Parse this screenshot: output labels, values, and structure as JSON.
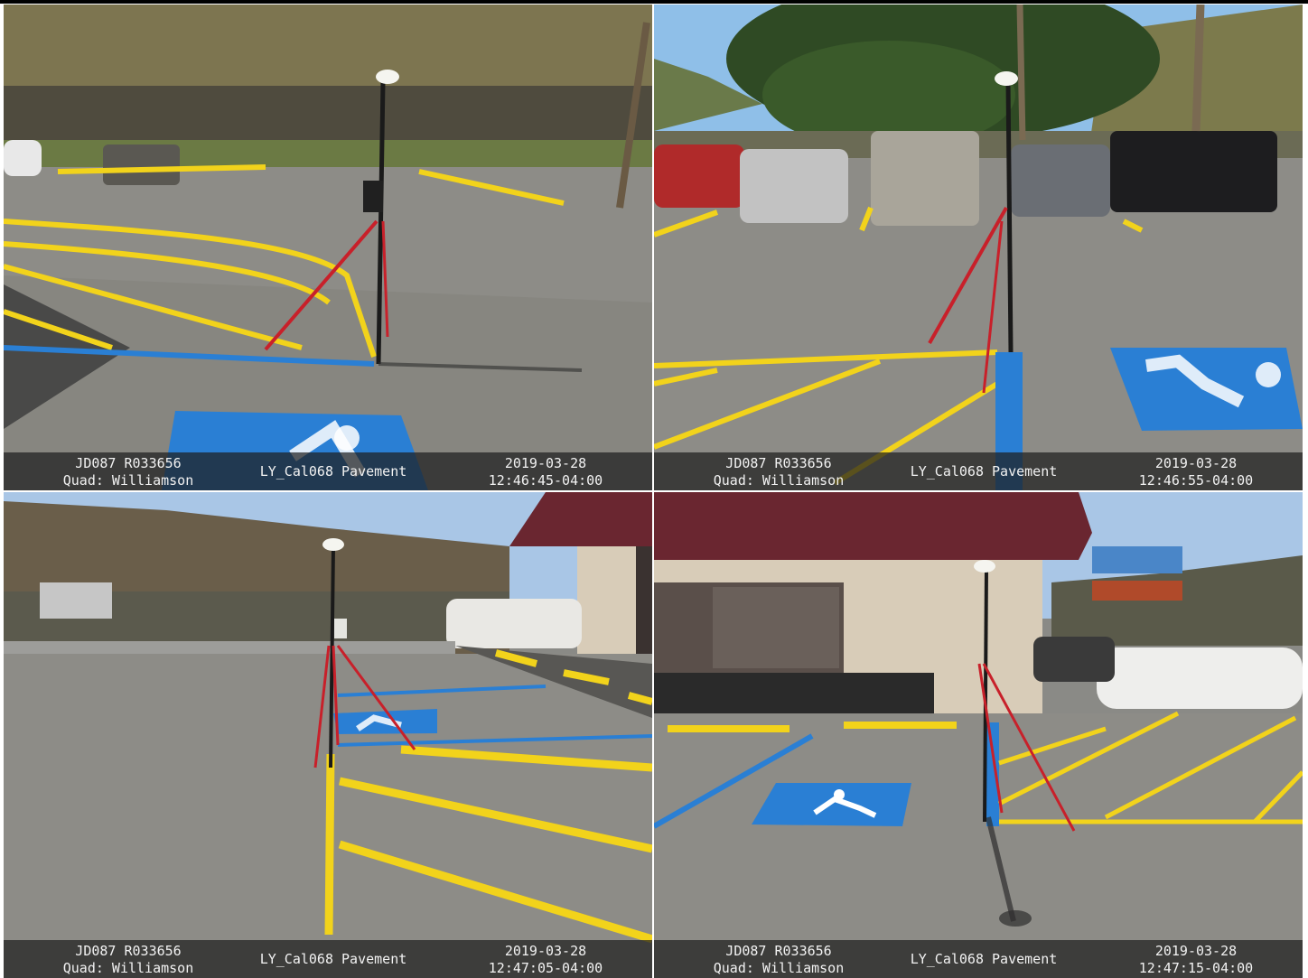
{
  "photos": [
    {
      "station": "JD087 R033656",
      "quad": "Quad: Williamson",
      "point": "LY_Cal068 Pavement",
      "date": "2019-03-28",
      "time": "12:46:45-04:00"
    },
    {
      "station": "JD087 R033656",
      "quad": "Quad: Williamson",
      "point": "LY_Cal068 Pavement",
      "date": "2019-03-28",
      "time": "12:46:55-04:00"
    },
    {
      "station": "JD087 R033656",
      "quad": "Quad: Williamson",
      "point": "LY_Cal068 Pavement",
      "date": "2019-03-28",
      "time": "12:47:05-04:00"
    },
    {
      "station": "JD087 R033656",
      "quad": "Quad: Williamson",
      "point": "LY_Cal068 Pavement",
      "date": "2019-03-28",
      "time": "12:47:15-04:00"
    }
  ],
  "colors": {
    "asphalt": "#8d8c87",
    "paint_yellow": "#f2d31b",
    "paint_blue": "#2a7fd4",
    "rod_red": "#c8202a",
    "sky": "#8fbfe8",
    "vegetation": "#5c6b3a",
    "caption_bg": "#1e1e1e",
    "caption_text": "#f2f2f2"
  }
}
